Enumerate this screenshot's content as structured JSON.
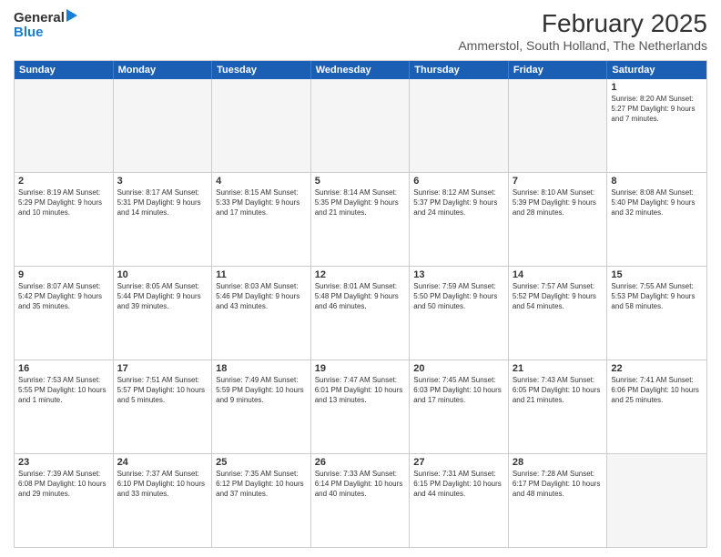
{
  "header": {
    "logo": {
      "general": "General",
      "blue": "Blue"
    },
    "title": "February 2025",
    "subtitle": "Ammerstol, South Holland, The Netherlands"
  },
  "days": [
    "Sunday",
    "Monday",
    "Tuesday",
    "Wednesday",
    "Thursday",
    "Friday",
    "Saturday"
  ],
  "weeks": [
    [
      {
        "day": "",
        "content": ""
      },
      {
        "day": "",
        "content": ""
      },
      {
        "day": "",
        "content": ""
      },
      {
        "day": "",
        "content": ""
      },
      {
        "day": "",
        "content": ""
      },
      {
        "day": "",
        "content": ""
      },
      {
        "day": "1",
        "content": "Sunrise: 8:20 AM\nSunset: 5:27 PM\nDaylight: 9 hours and 7 minutes."
      }
    ],
    [
      {
        "day": "2",
        "content": "Sunrise: 8:19 AM\nSunset: 5:29 PM\nDaylight: 9 hours and 10 minutes."
      },
      {
        "day": "3",
        "content": "Sunrise: 8:17 AM\nSunset: 5:31 PM\nDaylight: 9 hours and 14 minutes."
      },
      {
        "day": "4",
        "content": "Sunrise: 8:15 AM\nSunset: 5:33 PM\nDaylight: 9 hours and 17 minutes."
      },
      {
        "day": "5",
        "content": "Sunrise: 8:14 AM\nSunset: 5:35 PM\nDaylight: 9 hours and 21 minutes."
      },
      {
        "day": "6",
        "content": "Sunrise: 8:12 AM\nSunset: 5:37 PM\nDaylight: 9 hours and 24 minutes."
      },
      {
        "day": "7",
        "content": "Sunrise: 8:10 AM\nSunset: 5:39 PM\nDaylight: 9 hours and 28 minutes."
      },
      {
        "day": "8",
        "content": "Sunrise: 8:08 AM\nSunset: 5:40 PM\nDaylight: 9 hours and 32 minutes."
      }
    ],
    [
      {
        "day": "9",
        "content": "Sunrise: 8:07 AM\nSunset: 5:42 PM\nDaylight: 9 hours and 35 minutes."
      },
      {
        "day": "10",
        "content": "Sunrise: 8:05 AM\nSunset: 5:44 PM\nDaylight: 9 hours and 39 minutes."
      },
      {
        "day": "11",
        "content": "Sunrise: 8:03 AM\nSunset: 5:46 PM\nDaylight: 9 hours and 43 minutes."
      },
      {
        "day": "12",
        "content": "Sunrise: 8:01 AM\nSunset: 5:48 PM\nDaylight: 9 hours and 46 minutes."
      },
      {
        "day": "13",
        "content": "Sunrise: 7:59 AM\nSunset: 5:50 PM\nDaylight: 9 hours and 50 minutes."
      },
      {
        "day": "14",
        "content": "Sunrise: 7:57 AM\nSunset: 5:52 PM\nDaylight: 9 hours and 54 minutes."
      },
      {
        "day": "15",
        "content": "Sunrise: 7:55 AM\nSunset: 5:53 PM\nDaylight: 9 hours and 58 minutes."
      }
    ],
    [
      {
        "day": "16",
        "content": "Sunrise: 7:53 AM\nSunset: 5:55 PM\nDaylight: 10 hours and 1 minute."
      },
      {
        "day": "17",
        "content": "Sunrise: 7:51 AM\nSunset: 5:57 PM\nDaylight: 10 hours and 5 minutes."
      },
      {
        "day": "18",
        "content": "Sunrise: 7:49 AM\nSunset: 5:59 PM\nDaylight: 10 hours and 9 minutes."
      },
      {
        "day": "19",
        "content": "Sunrise: 7:47 AM\nSunset: 6:01 PM\nDaylight: 10 hours and 13 minutes."
      },
      {
        "day": "20",
        "content": "Sunrise: 7:45 AM\nSunset: 6:03 PM\nDaylight: 10 hours and 17 minutes."
      },
      {
        "day": "21",
        "content": "Sunrise: 7:43 AM\nSunset: 6:05 PM\nDaylight: 10 hours and 21 minutes."
      },
      {
        "day": "22",
        "content": "Sunrise: 7:41 AM\nSunset: 6:06 PM\nDaylight: 10 hours and 25 minutes."
      }
    ],
    [
      {
        "day": "23",
        "content": "Sunrise: 7:39 AM\nSunset: 6:08 PM\nDaylight: 10 hours and 29 minutes."
      },
      {
        "day": "24",
        "content": "Sunrise: 7:37 AM\nSunset: 6:10 PM\nDaylight: 10 hours and 33 minutes."
      },
      {
        "day": "25",
        "content": "Sunrise: 7:35 AM\nSunset: 6:12 PM\nDaylight: 10 hours and 37 minutes."
      },
      {
        "day": "26",
        "content": "Sunrise: 7:33 AM\nSunset: 6:14 PM\nDaylight: 10 hours and 40 minutes."
      },
      {
        "day": "27",
        "content": "Sunrise: 7:31 AM\nSunset: 6:15 PM\nDaylight: 10 hours and 44 minutes."
      },
      {
        "day": "28",
        "content": "Sunrise: 7:28 AM\nSunset: 6:17 PM\nDaylight: 10 hours and 48 minutes."
      },
      {
        "day": "",
        "content": ""
      }
    ]
  ]
}
